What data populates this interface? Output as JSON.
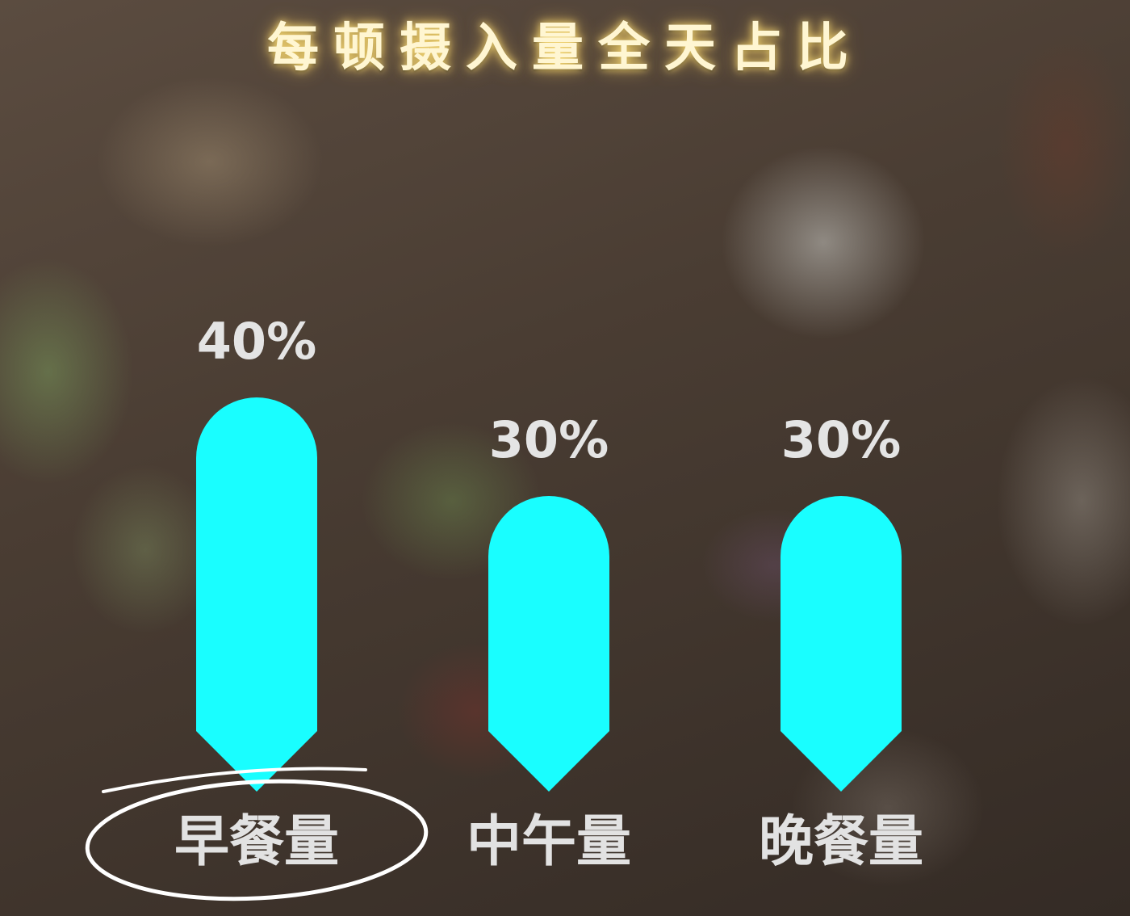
{
  "colors": {
    "bar": "#19feff",
    "highlight": "#ffffff"
  },
  "chart_data": {
    "type": "bar",
    "title": "每顿摄入量全天占比",
    "categories": [
      "早餐量",
      "中午量",
      "晚餐量"
    ],
    "values": [
      40,
      30,
      30
    ],
    "value_labels": [
      "40%",
      "30%",
      "30%"
    ],
    "unit": "%",
    "highlighted_category": "早餐量"
  }
}
